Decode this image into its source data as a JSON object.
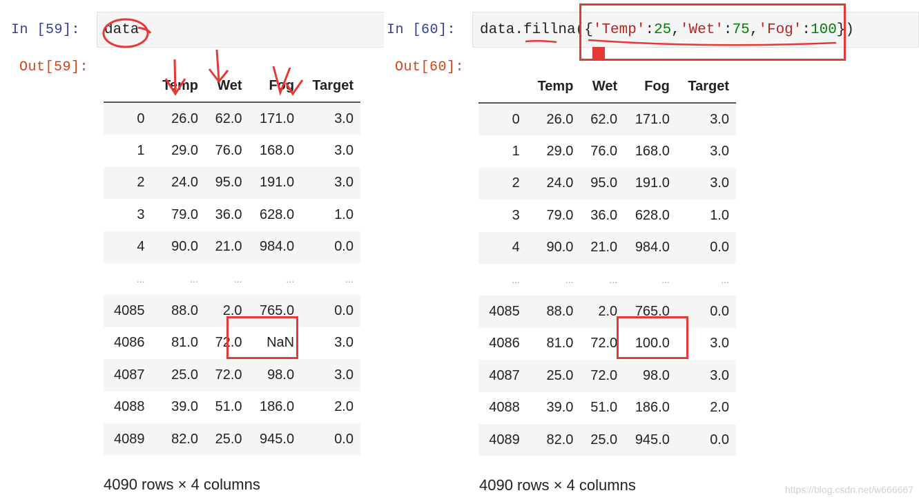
{
  "left": {
    "in_prompt": "In  [59]:",
    "out_prompt": "Out[59]:",
    "code": "data",
    "columns": [
      "",
      "Temp",
      "Wet",
      "Fog",
      "Target"
    ],
    "rows": [
      [
        "0",
        "26.0",
        "62.0",
        "171.0",
        "3.0"
      ],
      [
        "1",
        "29.0",
        "76.0",
        "168.0",
        "3.0"
      ],
      [
        "2",
        "24.0",
        "95.0",
        "191.0",
        "3.0"
      ],
      [
        "3",
        "79.0",
        "36.0",
        "628.0",
        "1.0"
      ],
      [
        "4",
        "90.0",
        "21.0",
        "984.0",
        "0.0"
      ],
      [
        "...",
        "...",
        "...",
        "...",
        "..."
      ],
      [
        "4085",
        "88.0",
        "2.0",
        "765.0",
        "0.0"
      ],
      [
        "4086",
        "81.0",
        "72.0",
        "NaN",
        "3.0"
      ],
      [
        "4087",
        "25.0",
        "72.0",
        "98.0",
        "3.0"
      ],
      [
        "4088",
        "39.0",
        "51.0",
        "186.0",
        "2.0"
      ],
      [
        "4089",
        "82.0",
        "25.0",
        "945.0",
        "0.0"
      ]
    ],
    "shape": "4090 rows × 4 columns"
  },
  "right": {
    "in_prompt": "In  [60]:",
    "out_prompt": "Out[60]:",
    "code_fn": "data.fillna",
    "code_args": [
      {
        "text": "({",
        "kind": "plain"
      },
      {
        "text": "'Temp'",
        "kind": "str"
      },
      {
        "text": ":",
        "kind": "plain"
      },
      {
        "text": "25",
        "kind": "num"
      },
      {
        "text": ",",
        "kind": "plain"
      },
      {
        "text": "'Wet'",
        "kind": "str"
      },
      {
        "text": ":",
        "kind": "plain"
      },
      {
        "text": "75",
        "kind": "num"
      },
      {
        "text": ",",
        "kind": "plain"
      },
      {
        "text": "'Fog'",
        "kind": "str"
      },
      {
        "text": ":",
        "kind": "plain"
      },
      {
        "text": "100",
        "kind": "num"
      },
      {
        "text": "})",
        "kind": "plain"
      }
    ],
    "columns": [
      "",
      "Temp",
      "Wet",
      "Fog",
      "Target"
    ],
    "rows": [
      [
        "0",
        "26.0",
        "62.0",
        "171.0",
        "3.0"
      ],
      [
        "1",
        "29.0",
        "76.0",
        "168.0",
        "3.0"
      ],
      [
        "2",
        "24.0",
        "95.0",
        "191.0",
        "3.0"
      ],
      [
        "3",
        "79.0",
        "36.0",
        "628.0",
        "1.0"
      ],
      [
        "4",
        "90.0",
        "21.0",
        "984.0",
        "0.0"
      ],
      [
        "...",
        "...",
        "...",
        "...",
        "..."
      ],
      [
        "4085",
        "88.0",
        "2.0",
        "765.0",
        "0.0"
      ],
      [
        "4086",
        "81.0",
        "72.0",
        "100.0",
        "3.0"
      ],
      [
        "4087",
        "25.0",
        "72.0",
        "98.0",
        "3.0"
      ],
      [
        "4088",
        "39.0",
        "51.0",
        "186.0",
        "2.0"
      ],
      [
        "4089",
        "82.0",
        "25.0",
        "945.0",
        "0.0"
      ]
    ],
    "shape": "4090 rows × 4 columns"
  },
  "watermark": "https://blog.csdn.net/w666667",
  "colors": {
    "annotation_red": "#e53935",
    "in_prompt": "#303f9f",
    "out_prompt": "#d84315",
    "string": "#ba2121",
    "number": "#008000"
  }
}
